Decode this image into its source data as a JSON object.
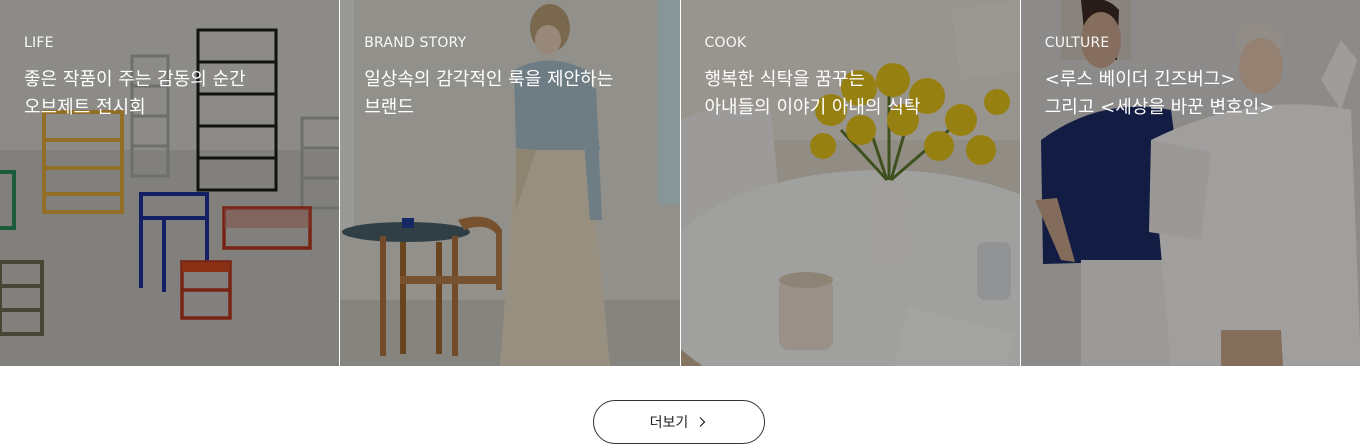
{
  "cards": [
    {
      "category": "LIFE",
      "title_line1": "좋은 작품이 주는 감동의 순간",
      "title_line2": "오브제트 전시회"
    },
    {
      "category": "BRAND STORY",
      "title_line1": "일상속의 감각적인 룩을 제안하는",
      "title_line2": "브랜드"
    },
    {
      "category": "COOK",
      "title_line1": "행복한 식탁을 꿈꾸는",
      "title_line2": "아내들의 이야기 아내의 식탁"
    },
    {
      "category": "CULTURE",
      "title_line1": "<루스 베이더 긴즈버그>",
      "title_line2": "그리고 <세상을 바꾼 변호인>"
    }
  ],
  "more_button": {
    "label": "더보기",
    "icon": "chevron-right-icon"
  },
  "colors": {
    "overlay": "rgba(0,0,0,0.34)",
    "button_border": "#333333",
    "text_on_image": "#ffffff"
  }
}
